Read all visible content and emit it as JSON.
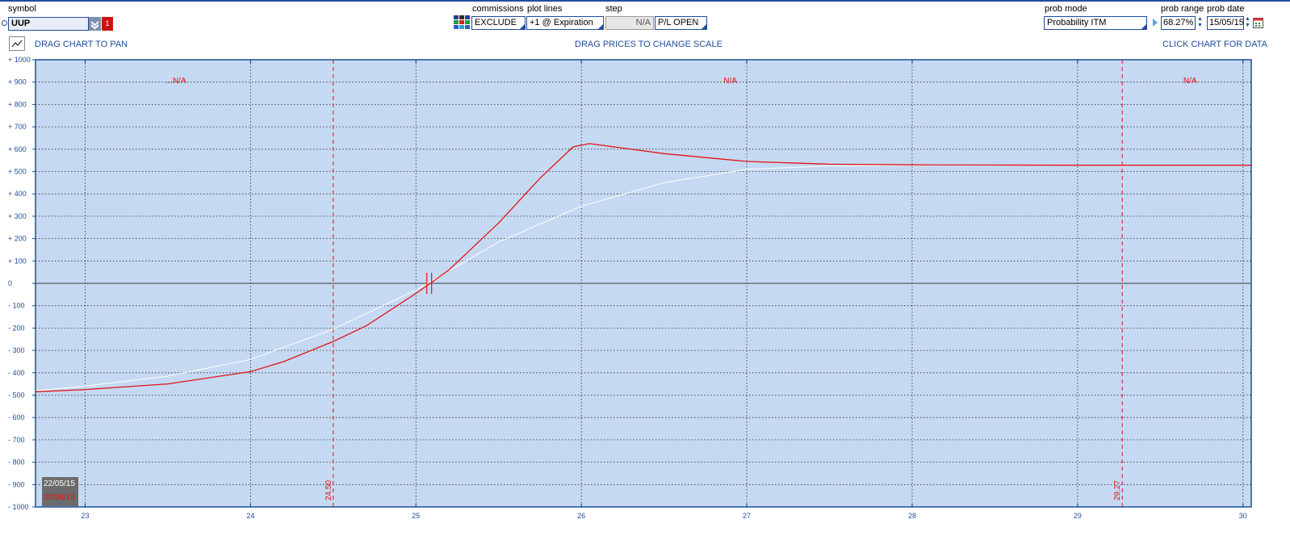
{
  "toolbar": {
    "symbol_label": "symbol",
    "symbol_value": "UUP",
    "symbol_badge": "1",
    "commissions_label": "commissions",
    "commissions_value": "EXCLUDE",
    "plot_lines_label": "plot lines",
    "plot_lines_value": "+1 @ Expiration",
    "step_label": "step",
    "step_value": "N/A",
    "pl_value": "P/L OPEN",
    "prob_mode_label": "prob mode",
    "prob_mode_value": "Probability ITM",
    "prob_range_label": "prob range",
    "prob_range_value": "68.27%",
    "prob_date_label": "prob date",
    "prob_date_value": "15/05/15"
  },
  "hints": {
    "pan": "DRAG CHART TO PAN",
    "scale": "DRAG PRICES TO CHANGE SCALE",
    "data": "CLICK CHART FOR DATA"
  },
  "dates": {
    "current": "22/05/15",
    "expiration": "20/06/15"
  },
  "colors": {
    "chart_bg": "#c5d9f2",
    "accent": "#1f4e9b",
    "expiration_line": "#e31414",
    "current_line": "#ffffff"
  },
  "chart_data": {
    "type": "line",
    "xlim": [
      22.7,
      30.05
    ],
    "ylim": [
      -1000,
      1000
    ],
    "xticks": [
      23,
      24,
      25,
      26,
      27,
      28,
      29,
      30
    ],
    "yticks": [
      1000,
      900,
      800,
      700,
      600,
      500,
      400,
      300,
      200,
      100,
      0,
      -100,
      -200,
      -300,
      -400,
      -500,
      -600,
      -700,
      -800,
      -900,
      -1000
    ],
    "ytick_labels": [
      "+ 1000",
      "+ 900",
      "+ 800",
      "+ 700",
      "+ 600",
      "+ 500",
      "+ 400",
      "+ 300",
      "+ 200",
      "+ 100",
      "0",
      "- 100",
      "- 200",
      "- 300",
      "- 400",
      "- 500",
      "- 600",
      "- 700",
      "- 800",
      "- 900",
      "- 1000"
    ],
    "grid": true,
    "series": [
      {
        "color": "#e31414",
        "x": [
          22.7,
          23.0,
          23.5,
          24.0,
          24.2,
          24.5,
          24.7,
          25.0,
          25.2,
          25.5,
          25.75,
          25.95,
          26.05,
          26.5,
          27.0,
          27.5,
          28.0,
          28.5,
          29.0,
          29.5,
          30.05
        ],
        "y": [
          -485,
          -475,
          -450,
          -395,
          -350,
          -260,
          -190,
          -45,
          60,
          270,
          470,
          610,
          625,
          580,
          545,
          533,
          530,
          529,
          528,
          528,
          528
        ]
      },
      {
        "color": "#ffffff",
        "x": [
          22.7,
          23.0,
          23.5,
          24.0,
          24.5,
          25.0,
          25.5,
          26.0,
          26.5,
          27.0,
          27.5,
          28.0,
          29.0,
          30.05
        ],
        "y": [
          -480,
          -460,
          -415,
          -340,
          -205,
          -30,
          185,
          345,
          450,
          510,
          525,
          528,
          528,
          528
        ]
      }
    ],
    "vertical_markers": [
      {
        "x": 24.5,
        "label": "24.50"
      },
      {
        "x": 29.27,
        "label": "29.27"
      }
    ],
    "region_labels": [
      {
        "x": 23.55,
        "text": "...N/A"
      },
      {
        "x": 26.9,
        "text": "N/A"
      },
      {
        "x": 29.68,
        "text": "N/A"
      }
    ],
    "breakeven_x": 25.08
  }
}
